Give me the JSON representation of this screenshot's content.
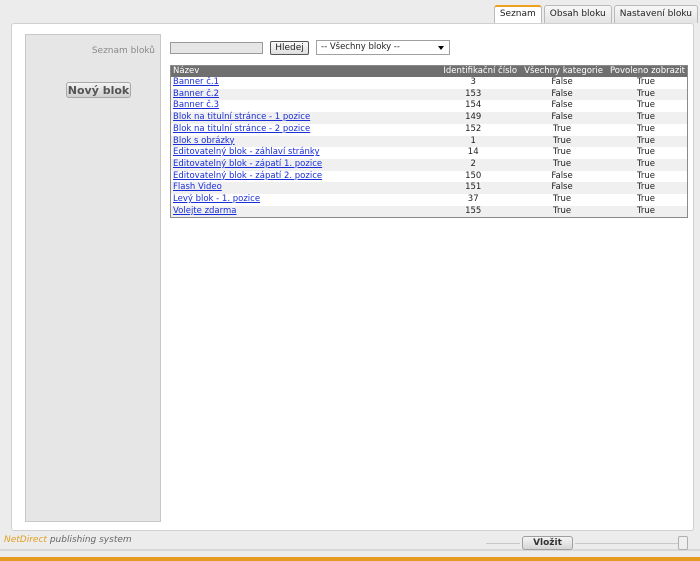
{
  "tabs": [
    {
      "label": "Seznam",
      "active": true
    },
    {
      "label": "Obsah bloku",
      "active": false
    },
    {
      "label": "Nastavení bloku",
      "active": false
    }
  ],
  "sidebar": {
    "title": "Seznam bloků",
    "new_button": "Nový blok"
  },
  "search": {
    "value": "",
    "button": "Hledej",
    "filter_selected": "-- Všechny bloky --"
  },
  "table": {
    "headers": {
      "name": "Název",
      "id": "Identifikační číslo",
      "all_categories": "Všechny kategorie",
      "visible": "Povoleno zobrazit"
    },
    "rows": [
      {
        "name": "Banner č.1",
        "id": "3",
        "all_categories": "False",
        "visible": "True"
      },
      {
        "name": "Banner č.2",
        "id": "153",
        "all_categories": "False",
        "visible": "True"
      },
      {
        "name": "Banner č.3",
        "id": "154",
        "all_categories": "False",
        "visible": "True"
      },
      {
        "name": "Blok na titulní stránce - 1 pozice",
        "id": "149",
        "all_categories": "False",
        "visible": "True"
      },
      {
        "name": "Blok na titulní stránce - 2 pozice",
        "id": "152",
        "all_categories": "True",
        "visible": "True"
      },
      {
        "name": "Blok s obrázky",
        "id": "1",
        "all_categories": "True",
        "visible": "True"
      },
      {
        "name": "Editovatelný blok - záhlaví stránky",
        "id": "14",
        "all_categories": "True",
        "visible": "True"
      },
      {
        "name": "Editovatelný blok - zápatí 1. pozice",
        "id": "2",
        "all_categories": "True",
        "visible": "True"
      },
      {
        "name": "Editovatelný blok - zápatí 2. pozice",
        "id": "150",
        "all_categories": "False",
        "visible": "True"
      },
      {
        "name": "Flash Video",
        "id": "151",
        "all_categories": "False",
        "visible": "True"
      },
      {
        "name": "Levý blok - 1. pozice",
        "id": "37",
        "all_categories": "True",
        "visible": "True"
      },
      {
        "name": "Volejte zdarma",
        "id": "155",
        "all_categories": "True",
        "visible": "True"
      }
    ]
  },
  "footer": {
    "brand_part1": "NetDirect",
    "brand_part2": " publishing system",
    "insert_button": "Vložit"
  },
  "colors": {
    "accent": "#e89a20",
    "link": "#1a2ed8",
    "table_header": "#6f6f6f"
  }
}
